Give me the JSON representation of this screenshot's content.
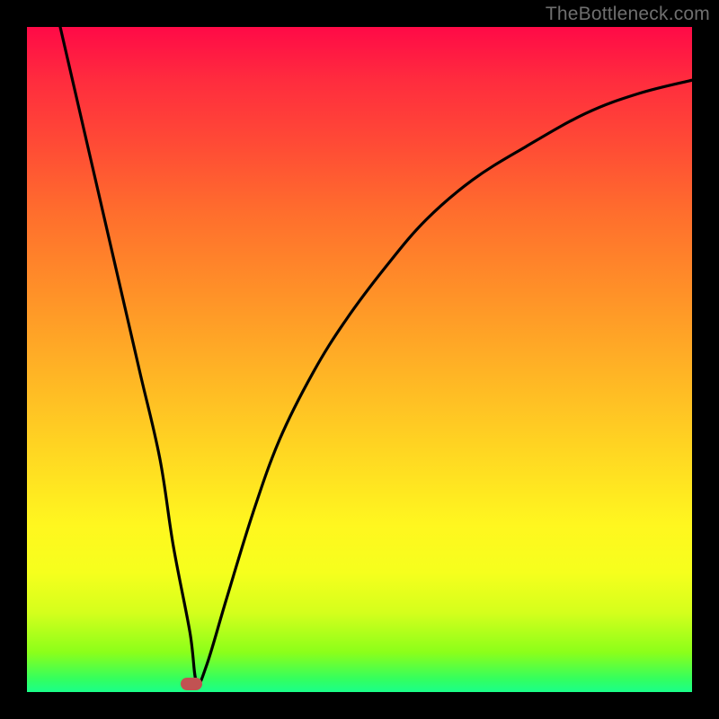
{
  "watermark": "TheBottleneck.com",
  "chart_data": {
    "type": "line",
    "title": "",
    "xlabel": "",
    "ylabel": "",
    "xlim": [
      0,
      100
    ],
    "ylim": [
      0,
      100
    ],
    "grid": false,
    "legend": false,
    "series": [
      {
        "name": "bottleneck-curve",
        "x": [
          5,
          8,
          11,
          14,
          17,
          20,
          22,
          24.5,
          25.5,
          27,
          30,
          34,
          38,
          43,
          48,
          54,
          60,
          67,
          75,
          84,
          92,
          100
        ],
        "y": [
          100,
          87,
          74,
          61,
          48,
          35,
          22,
          9,
          1.5,
          4,
          14,
          27,
          38,
          48,
          56,
          64,
          71,
          77,
          82,
          87,
          90,
          92
        ]
      }
    ],
    "marker": {
      "x": 24.7,
      "y": 1.2
    },
    "background_gradient": {
      "top": "#ff0a47",
      "middle": "#ffd722",
      "bottom": "#1aff8a"
    }
  }
}
